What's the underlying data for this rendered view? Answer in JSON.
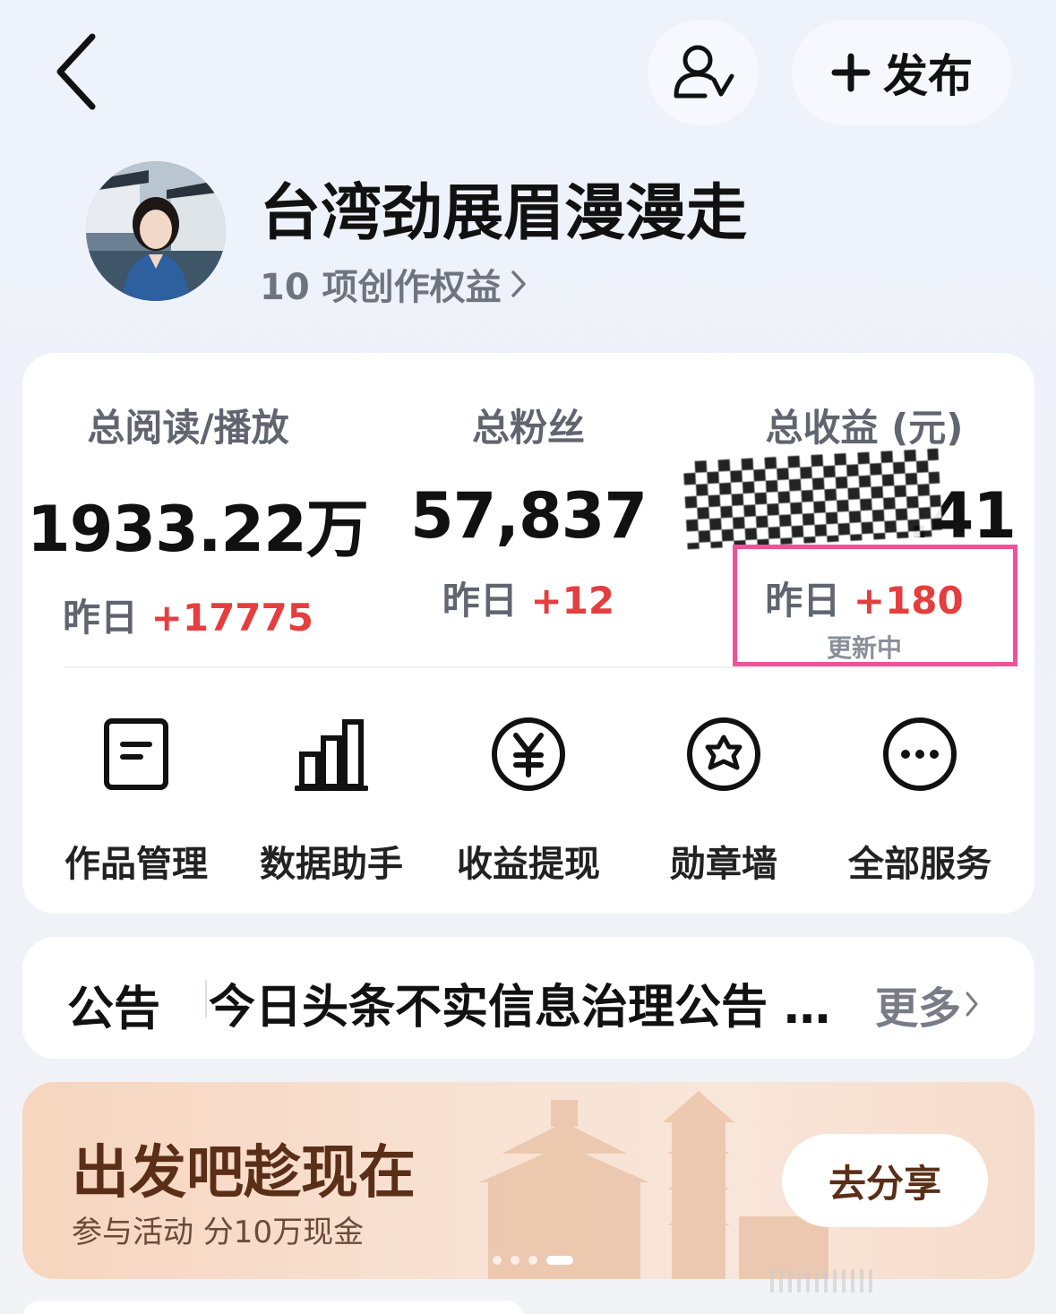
{
  "header": {
    "back_icon": "chevron-left-icon",
    "user_switch_icon": "user-check-icon",
    "publish_label": "发布",
    "publish_icon": "plus-icon"
  },
  "profile": {
    "name": "台湾劲展眉漫漫走",
    "rights": "10 项创作权益",
    "rights_chevron": "›"
  },
  "stats": [
    {
      "label": "总阅读/播放",
      "value": "1933.22万",
      "delta_prefix": "昨日 ",
      "delta": "+17775"
    },
    {
      "label": "总粉丝",
      "value": "57,837",
      "delta_prefix": "昨日 ",
      "delta": "+12"
    },
    {
      "label": "总收益 (元)",
      "value": ".41",
      "delta_prefix": "昨日 ",
      "delta": "+180",
      "status": "更新中"
    }
  ],
  "tools": [
    {
      "label": "作品管理",
      "icon": "document-icon"
    },
    {
      "label": "数据助手",
      "icon": "bar-chart-icon"
    },
    {
      "label": "收益提现",
      "icon": "yen-circle-icon"
    },
    {
      "label": "勋章墙",
      "icon": "badge-star-icon"
    },
    {
      "label": "全部服务",
      "icon": "more-dots-icon"
    }
  ],
  "notice": {
    "title": "公告",
    "text": "今日头条不实信息治理公告 …",
    "more": "更多",
    "more_chevron": "›"
  },
  "banner": {
    "title": "出发吧趁现在",
    "subtitle": "参与活动 分10万现金",
    "button": "去分享",
    "page_count": 4,
    "active_page": 4
  },
  "colors": {
    "accent_red": "#e53e3e",
    "highlight_pink": "#f0529a",
    "banner_text": "#5a2e17"
  }
}
